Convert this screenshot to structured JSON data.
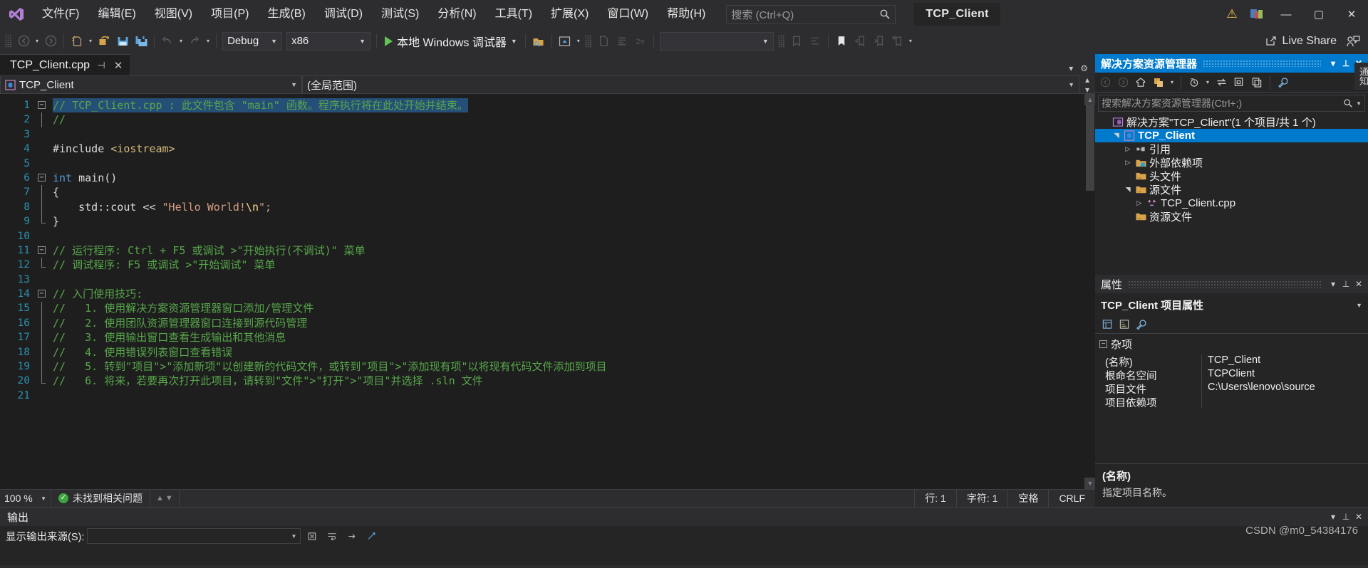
{
  "titlebar": {
    "logo": "vs-logo",
    "menus": [
      {
        "label": "文件(F)"
      },
      {
        "label": "编辑(E)"
      },
      {
        "label": "视图(V)"
      },
      {
        "label": "项目(P)"
      },
      {
        "label": "生成(B)"
      },
      {
        "label": "调试(D)"
      },
      {
        "label": "测试(S)"
      },
      {
        "label": "分析(N)"
      },
      {
        "label": "工具(T)"
      },
      {
        "label": "扩展(X)"
      },
      {
        "label": "窗口(W)"
      },
      {
        "label": "帮助(H)"
      }
    ],
    "search_placeholder": "搜索 (Ctrl+Q)",
    "project_title": "TCP_Client",
    "minimize": "—",
    "maximize": "▢",
    "close": "✕"
  },
  "toolbar": {
    "config": "Debug",
    "platform": "x86",
    "run_label": "本地 Windows 调试器",
    "find_value": "",
    "live_share": "Live Share"
  },
  "editor": {
    "tab": {
      "name": "TCP_Client.cpp",
      "pin": "⊣",
      "close": "✕"
    },
    "nav_left": "TCP_Client",
    "nav_right": "(全局范围)",
    "lines": [
      {
        "n": 1,
        "fold": "minus",
        "segs": [
          {
            "t": "// TCP_Client.cpp : 此文件包含 \"main\" 函数。程序执行将在此处开始并结束。",
            "c": "c-com",
            "sel": true
          }
        ]
      },
      {
        "n": 2,
        "fold": "bar",
        "segs": [
          {
            "t": "//",
            "c": "c-com"
          }
        ]
      },
      {
        "n": 3,
        "fold": "none",
        "segs": []
      },
      {
        "n": 4,
        "fold": "none",
        "segs": [
          {
            "t": "#include ",
            "c": "c-pp"
          },
          {
            "t": "<iostream>",
            "c": "c-inc"
          }
        ]
      },
      {
        "n": 5,
        "fold": "none",
        "segs": []
      },
      {
        "n": 6,
        "fold": "minus",
        "segs": [
          {
            "t": "int",
            "c": "c-kw"
          },
          {
            "t": " main()",
            "c": "c-pl"
          }
        ]
      },
      {
        "n": 7,
        "fold": "bar",
        "segs": [
          {
            "t": "{",
            "c": "c-pl"
          }
        ]
      },
      {
        "n": 8,
        "fold": "bar",
        "segs": [
          {
            "t": "    std::cout << ",
            "c": "c-pl"
          },
          {
            "t": "\"Hello World!",
            "c": "c-str"
          },
          {
            "t": "\\n",
            "c": "c-esc"
          },
          {
            "t": "\";",
            "c": "c-str"
          }
        ]
      },
      {
        "n": 9,
        "fold": "end",
        "segs": [
          {
            "t": "}",
            "c": "c-pl"
          }
        ]
      },
      {
        "n": 10,
        "fold": "none",
        "segs": []
      },
      {
        "n": 11,
        "fold": "minus",
        "segs": [
          {
            "t": "// 运行程序: Ctrl + F5 或调试 >\"开始执行(不调试)\" 菜单",
            "c": "c-com"
          }
        ]
      },
      {
        "n": 12,
        "fold": "end",
        "segs": [
          {
            "t": "// 调试程序: F5 或调试 >\"开始调试\" 菜单",
            "c": "c-com"
          }
        ]
      },
      {
        "n": 13,
        "fold": "none",
        "segs": []
      },
      {
        "n": 14,
        "fold": "minus",
        "segs": [
          {
            "t": "// 入门使用技巧:",
            "c": "c-com"
          }
        ]
      },
      {
        "n": 15,
        "fold": "bar",
        "segs": [
          {
            "t": "//   1. 使用解决方案资源管理器窗口添加/管理文件",
            "c": "c-com"
          }
        ]
      },
      {
        "n": 16,
        "fold": "bar",
        "segs": [
          {
            "t": "//   2. 使用团队资源管理器窗口连接到源代码管理",
            "c": "c-com"
          }
        ]
      },
      {
        "n": 17,
        "fold": "bar",
        "segs": [
          {
            "t": "//   3. 使用输出窗口查看生成输出和其他消息",
            "c": "c-com"
          }
        ]
      },
      {
        "n": 18,
        "fold": "bar",
        "segs": [
          {
            "t": "//   4. 使用错误列表窗口查看错误",
            "c": "c-com"
          }
        ]
      },
      {
        "n": 19,
        "fold": "bar",
        "segs": [
          {
            "t": "//   5. 转到\"项目\">\"添加新项\"以创建新的代码文件，或转到\"项目\">\"添加现有项\"以将现有代码文件添加到项目",
            "c": "c-com"
          }
        ]
      },
      {
        "n": 20,
        "fold": "end",
        "segs": [
          {
            "t": "//   6. 将来，若要再次打开此项目，请转到\"文件\">\"打开\">\"项目\"并选择 .sln 文件",
            "c": "c-com"
          }
        ]
      },
      {
        "n": 21,
        "fold": "none",
        "segs": []
      }
    ]
  },
  "editor_status": {
    "zoom": "100 %",
    "errors": "未找到相关问题",
    "line": "行: 1",
    "col": "字符: 1",
    "indent": "空格",
    "eol": "CRLF"
  },
  "solution_explorer": {
    "title": "解决方案资源管理器",
    "search_placeholder": "搜索解决方案资源管理器(Ctrl+;)",
    "tree": [
      {
        "label": "解决方案\"TCP_Client\"(1 个项目/共 1 个)",
        "icon": "solution-icon",
        "indent": 0,
        "twist": "none",
        "selected": false
      },
      {
        "label": "TCP_Client",
        "icon": "project-icon",
        "indent": 1,
        "twist": "open",
        "selected": true
      },
      {
        "label": "引用",
        "icon": "references-icon",
        "indent": 2,
        "twist": "closed",
        "selected": false
      },
      {
        "label": "外部依赖项",
        "icon": "folder-deps-icon",
        "indent": 2,
        "twist": "closed",
        "selected": false
      },
      {
        "label": "头文件",
        "icon": "folder-icon",
        "indent": 2,
        "twist": "none",
        "selected": false
      },
      {
        "label": "源文件",
        "icon": "folder-icon",
        "indent": 2,
        "twist": "open",
        "selected": false
      },
      {
        "label": "TCP_Client.cpp",
        "icon": "cpp-file-icon",
        "indent": 3,
        "twist": "closed",
        "selected": false
      },
      {
        "label": "资源文件",
        "icon": "folder-icon",
        "indent": 2,
        "twist": "none",
        "selected": false
      }
    ]
  },
  "properties": {
    "title": "属性",
    "subtitle": "TCP_Client 项目属性",
    "category": "杂项",
    "rows": [
      {
        "key": "(名称)",
        "value": "TCP_Client"
      },
      {
        "key": "根命名空间",
        "value": "TCPClient"
      },
      {
        "key": "项目文件",
        "value": "C:\\Users\\lenovo\\source"
      },
      {
        "key": "项目依赖项",
        "value": ""
      }
    ],
    "footer_title": "(名称)",
    "footer_desc": "指定项目名称。"
  },
  "vertical_tabs": [
    {
      "label": "通知"
    }
  ],
  "output": {
    "title": "输出",
    "source_label": "显示输出来源(S):",
    "source_value": ""
  },
  "watermark": "CSDN @m0_54384176",
  "colors": {
    "accent": "#007acc",
    "comment": "#57a64a",
    "keyword": "#569cd6",
    "string": "#d69d85",
    "linenum": "#2b91af",
    "bg_editor": "#1e1e1e",
    "bg_chrome": "#2d2d30",
    "bg_panel": "#252526"
  }
}
